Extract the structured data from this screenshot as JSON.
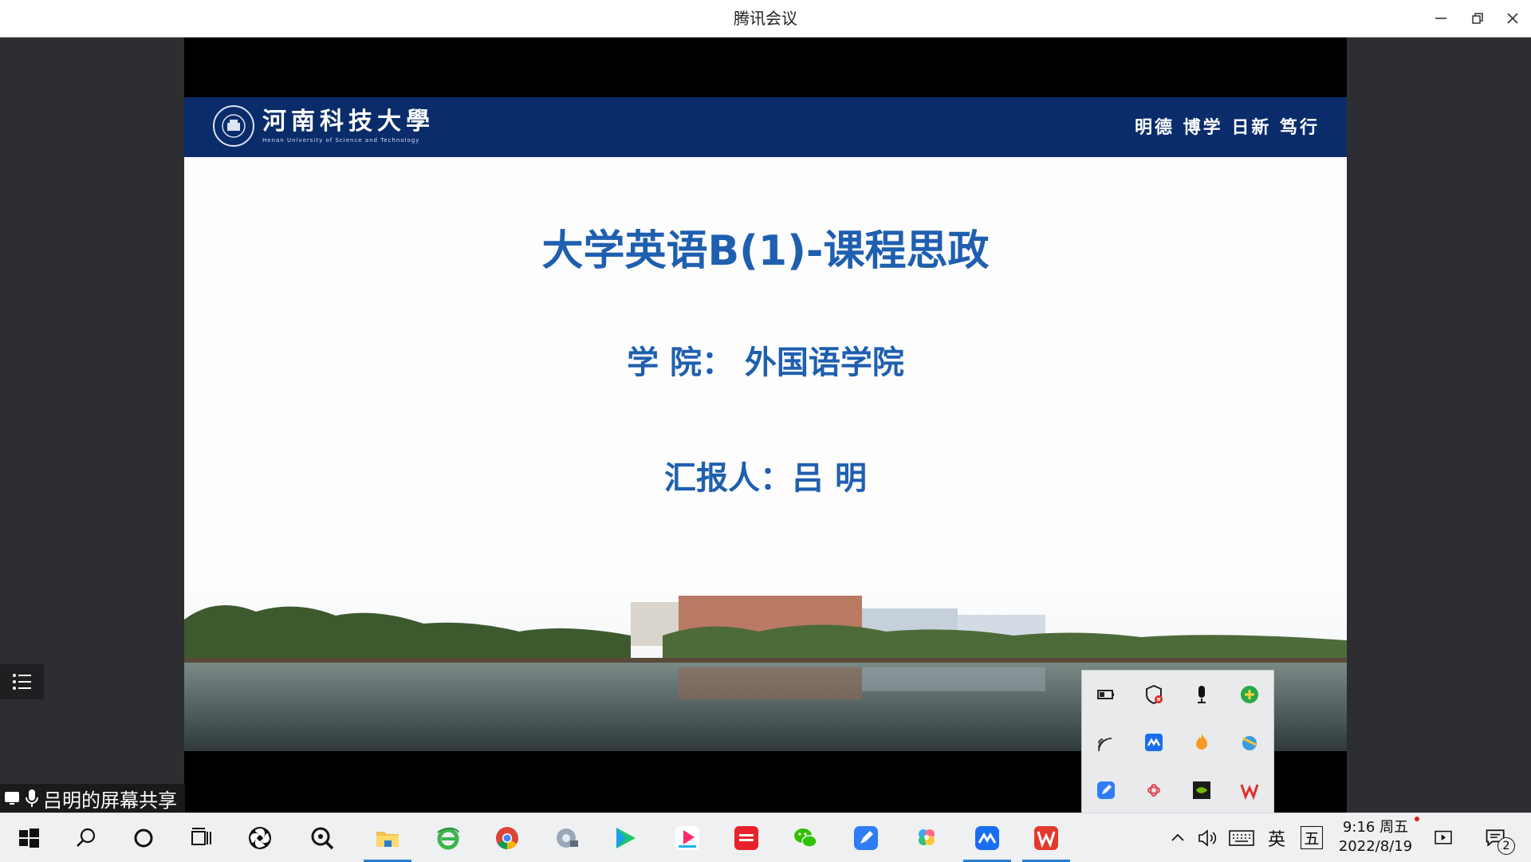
{
  "window": {
    "title": "腾讯会议"
  },
  "slide": {
    "university_cn": "河南科技大學",
    "university_en": "Henan University of Science and Technology",
    "motto": "明德 博学 日新 笃行",
    "title": "大学英语B(1)-课程思政",
    "college": "学 院：   外国语学院",
    "reporter": "汇报人：吕 明"
  },
  "share": {
    "label": "吕明的屏幕共享"
  },
  "tray": {
    "ime": "英",
    "ime_mode": "五",
    "notification_count": "2"
  },
  "clock": {
    "time": "9:16 周五",
    "date": "2022/8/19"
  },
  "colors": {
    "header_blue": "#0a2c6b",
    "title_blue": "#1f5faf",
    "taskbar_accent": "#2b7cd3"
  }
}
